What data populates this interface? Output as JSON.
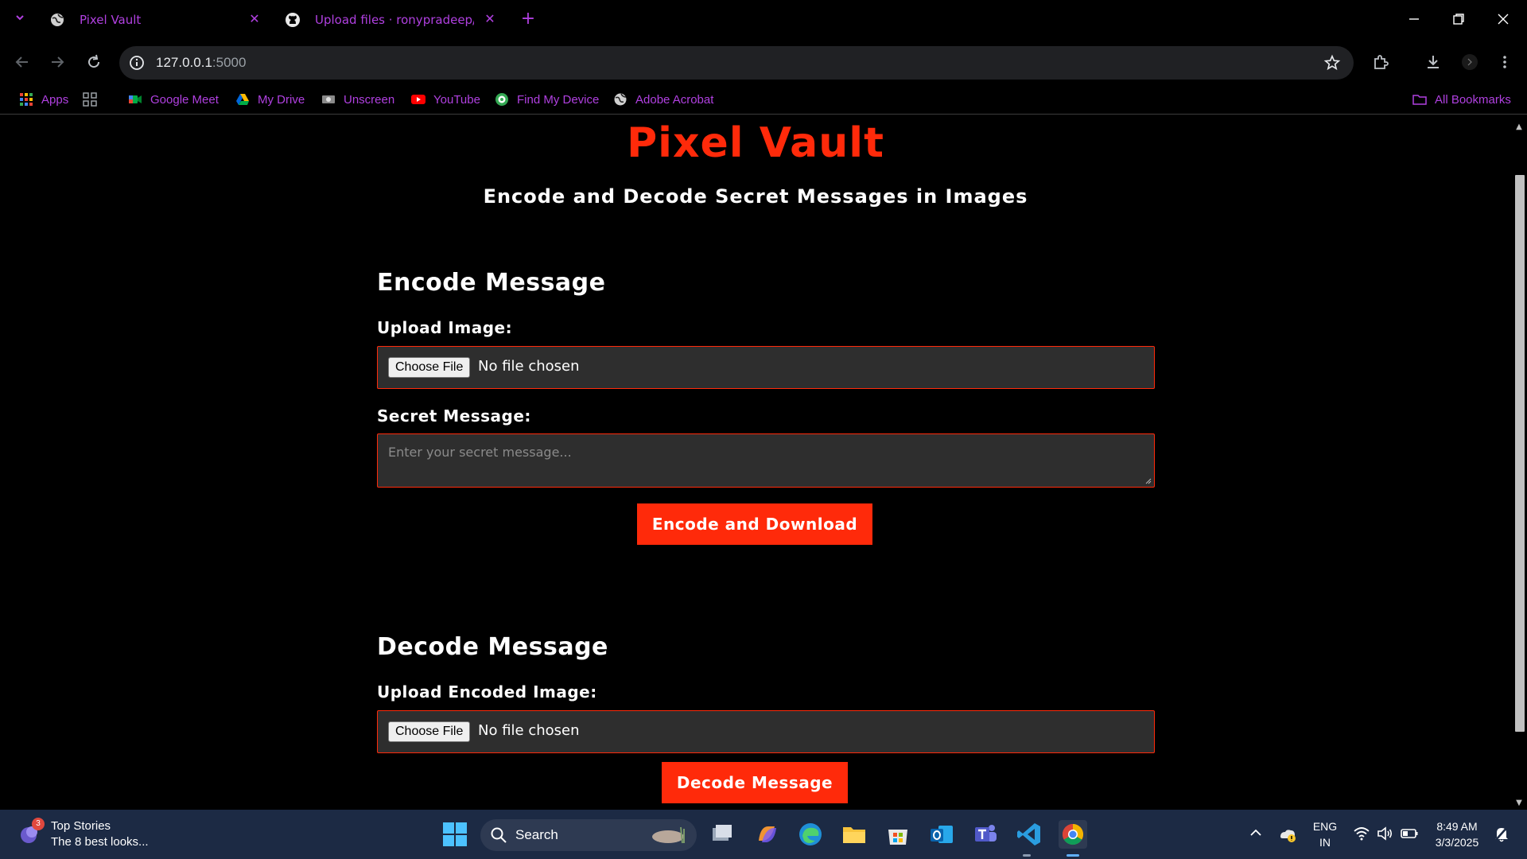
{
  "browser": {
    "tabs": [
      {
        "title": "Pixel Vault",
        "active": true
      },
      {
        "title": "Upload files · ronypradeep/Pixe"
      }
    ],
    "url_host": "127.0.0.1",
    "url_port": ":5000",
    "bookmarks": [
      {
        "label": "Apps",
        "icon": "apps-grid-icon"
      },
      {
        "label": "Google Meet",
        "icon": "google-meet-icon"
      },
      {
        "label": "My Drive",
        "icon": "google-drive-icon"
      },
      {
        "label": "Unscreen",
        "icon": "unscreen-icon"
      },
      {
        "label": "YouTube",
        "icon": "youtube-icon"
      },
      {
        "label": "Find My Device",
        "icon": "find-my-device-icon"
      },
      {
        "label": "Adobe Acrobat",
        "icon": "globe-icon"
      }
    ],
    "all_bookmarks": "All Bookmarks",
    "accent_color": "#b040e0"
  },
  "page": {
    "title": "Pixel Vault",
    "subtitle": "Encode and Decode Secret Messages in Images",
    "accent_color": "#ff2a0a",
    "encode": {
      "heading": "Encode Message",
      "upload_label": "Upload Image:",
      "choose_file": "Choose File",
      "no_file": "No file chosen",
      "message_label": "Secret Message:",
      "message_placeholder": "Enter your secret message...",
      "button": "Encode and Download"
    },
    "decode": {
      "heading": "Decode Message",
      "upload_label": "Upload Encoded Image:",
      "choose_file": "Choose File",
      "no_file": "No file chosen",
      "button": "Decode Message"
    }
  },
  "taskbar": {
    "news_badge": "3",
    "news_title": "Top Stories",
    "news_subtitle": "The 8 best looks...",
    "search_label": "Search",
    "lang_top": "ENG",
    "lang_bottom": "IN",
    "time": "8:49 AM",
    "date": "3/3/2025"
  }
}
